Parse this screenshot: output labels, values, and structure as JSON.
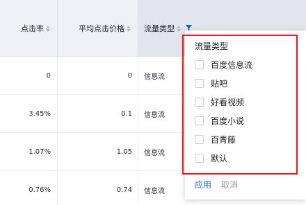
{
  "table": {
    "headers": {
      "click_rate": "点击率",
      "avg_click_price": "平均点击价格",
      "traffic_type": "流量类型"
    },
    "rows": [
      {
        "click_rate": "0",
        "avg_click_price": "0",
        "traffic_type": "信息流"
      },
      {
        "click_rate": "3.45%",
        "avg_click_price": "0.1",
        "traffic_type": "信息流"
      },
      {
        "click_rate": "1.07%",
        "avg_click_price": "1.05",
        "traffic_type": "信息流"
      },
      {
        "click_rate": "0.76%",
        "avg_click_price": "0.74",
        "traffic_type": "信息流"
      }
    ]
  },
  "filter_dropdown": {
    "title": "流量类型",
    "options": [
      "百度信息流",
      "贴吧",
      "好看视频",
      "百度小说",
      "百青藤",
      "默认"
    ],
    "apply_label": "应用",
    "cancel_label": "取消"
  },
  "colors": {
    "header_bg": "#eef0f6",
    "filter_active": "#1f5ee8",
    "highlight_border": "#e8171c"
  },
  "icons": {
    "sort": "sort-caret-icon",
    "filter": "funnel-filter-icon"
  }
}
